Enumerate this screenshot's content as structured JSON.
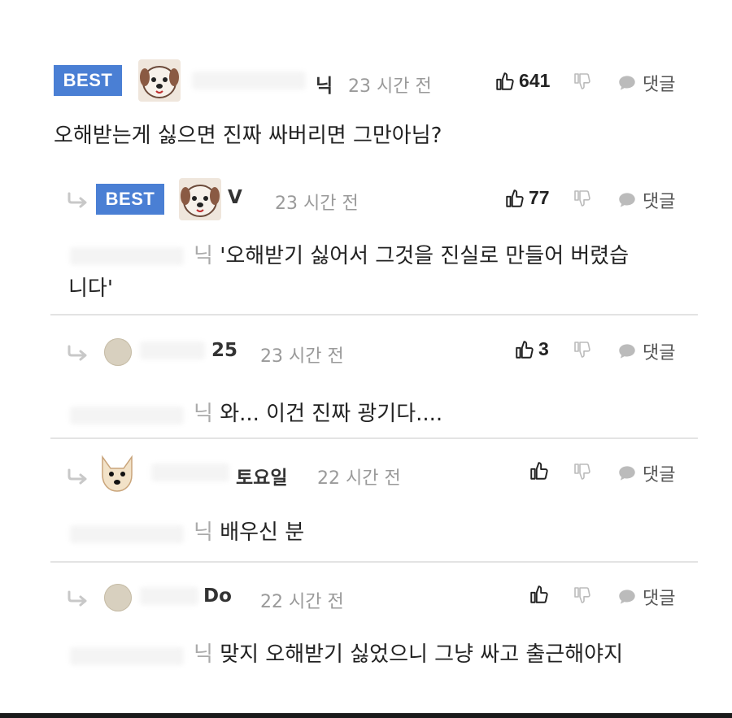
{
  "comments": [
    {
      "best": true,
      "badge": "BEST",
      "name": "닉",
      "time": "23 시간 전",
      "likes": "641",
      "reply": "댓글",
      "text": "오해받는게 싫으면 진짜 싸버리면 그만아님?"
    },
    {
      "best": true,
      "badge": "BEST",
      "name": "V",
      "time": "23 시간 전",
      "likes": "77",
      "reply": "댓글",
      "mention": "닉",
      "text": "'오해받기 싫어서 그것을 진실로 만들어 버렸습",
      "text2": "니다'"
    },
    {
      "name": "25",
      "time": "23 시간 전",
      "likes": "3",
      "reply": "댓글",
      "mention": "닉",
      "text": "와... 이건 진짜 광기다...."
    },
    {
      "name": "토요일",
      "time": "22 시간 전",
      "likes": "",
      "reply": "댓글",
      "mention": "닉",
      "text": "배우신 분"
    },
    {
      "name": "Do",
      "time": "22 시간 전",
      "likes": "",
      "reply": "댓글",
      "mention": "닉",
      "text": "맞지 오해받기 싫었으니 그냥 싸고 출근해야지"
    }
  ],
  "colors": {
    "best_badge": "#4a7fd4",
    "meta_gray": "#9a9a9a",
    "divider": "#e3e3e3"
  },
  "icons": {
    "like": "thumbs-up-icon",
    "dislike": "thumbs-down-icon",
    "reply": "speech-bubble-icon",
    "reply_indent": "reply-arrow-icon"
  }
}
